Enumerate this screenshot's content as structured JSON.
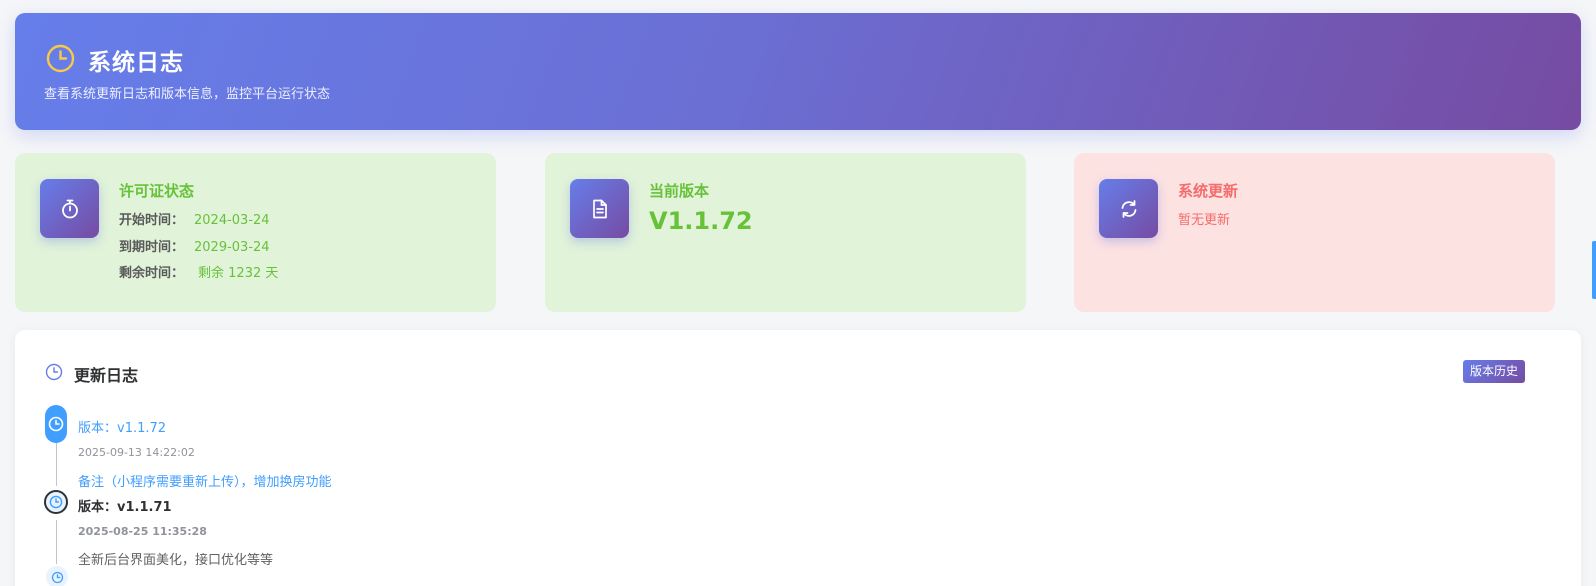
{
  "header": {
    "title": "系统日志",
    "subtitle": "查看系统更新日志和版本信息，监控平台运行状态"
  },
  "license": {
    "title": "许可证状态",
    "start_label": "开始时间：",
    "start_value": "2024-03-24",
    "end_label": "到期时间：",
    "end_value": "2029-03-24",
    "remain_label": "剩余时间：",
    "remain_value": "剩余 1232 天"
  },
  "version": {
    "title": "当前版本",
    "value": "V1.1.72"
  },
  "update": {
    "title": "系统更新",
    "status": "暂无更新"
  },
  "changelog": {
    "title": "更新日志",
    "history_button": "版本历史",
    "entries": [
      {
        "version": "版本：v1.1.72",
        "date": "2025-09-13 14:22:02",
        "note": "备注（小程序需要重新上传），增加换房功能"
      },
      {
        "version_label": "版本：",
        "version_value": "v1.1.71",
        "date": "2025-08-25 11:35:28",
        "note": "全新后台界面美化，接口优化等等"
      }
    ]
  },
  "colors": {
    "accent_start": "#667eea",
    "accent_end": "#764ba2",
    "success": "#67c23a",
    "danger": "#f56c6c",
    "link": "#409eff"
  }
}
